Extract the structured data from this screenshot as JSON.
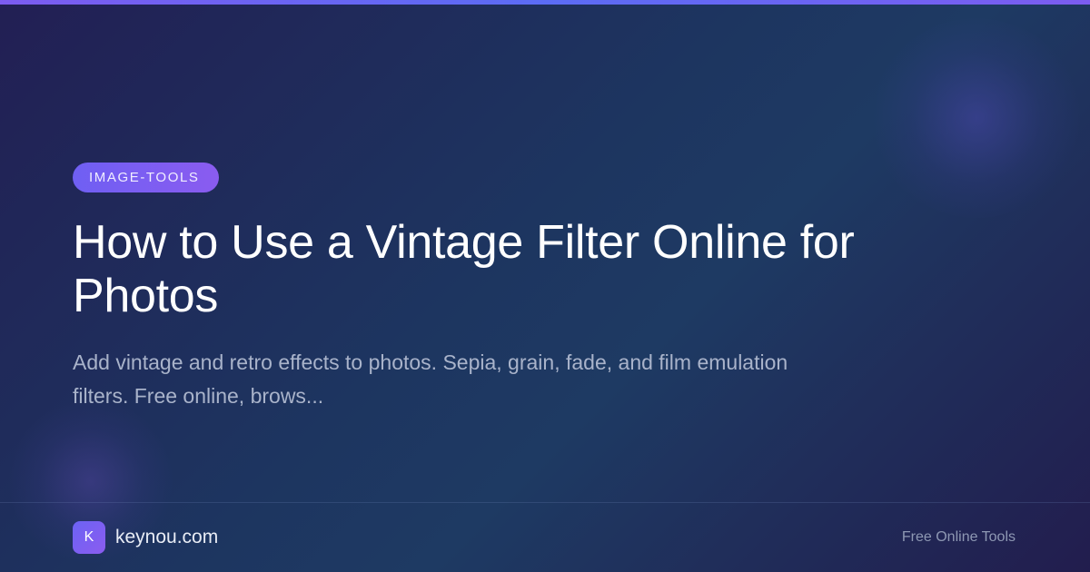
{
  "category": "IMAGE-TOOLS",
  "headline": "How to Use a Vintage Filter Online for Photos",
  "description": "Add vintage and retro effects to photos. Sepia, grain, fade, and film emulation filters. Free online, brows...",
  "brand": {
    "logo_letter": "K",
    "name": "keynou.com"
  },
  "tagline": "Free Online Tools",
  "colors": {
    "accent": "#7c5cf0",
    "pill_gradient_start": "#6f5ff3",
    "pill_gradient_end": "#8a5cf0",
    "background_dark": "#221f54",
    "background_mid": "#1d3560"
  }
}
